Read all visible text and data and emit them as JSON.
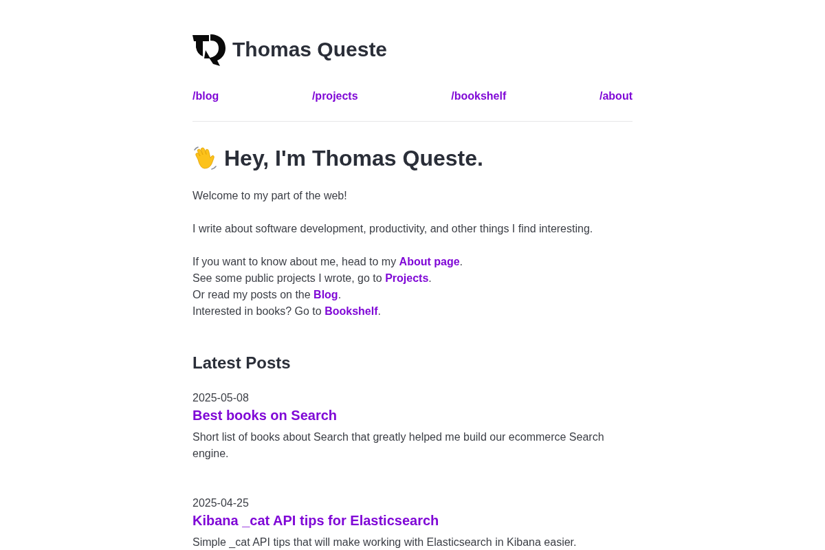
{
  "header": {
    "title": "Thomas Queste"
  },
  "nav": [
    {
      "label": "/blog"
    },
    {
      "label": "/projects"
    },
    {
      "label": "/bookshelf"
    },
    {
      "label": "/about"
    }
  ],
  "intro": {
    "heading": "Hey, I'm Thomas Queste.",
    "paragraphs": [
      "Welcome to my part of the web!",
      "I write about software development, productivity, and other things I find interesting."
    ],
    "link_lines": [
      {
        "before": "If you want to know about me, head to my ",
        "link": "About page",
        "after": "."
      },
      {
        "before": "See some public projects I wrote, go to ",
        "link": "Projects",
        "after": "."
      },
      {
        "before": "Or read my posts on the ",
        "link": "Blog",
        "after": "."
      },
      {
        "before": "Interested in books? Go to ",
        "link": "Bookshelf",
        "after": "."
      }
    ]
  },
  "latest_posts": {
    "heading": "Latest Posts",
    "posts": [
      {
        "date": "2025-05-08",
        "title": "Best books on Search",
        "summary": "Short list of books about Search that greatly helped me build our ecommerce Search engine."
      },
      {
        "date": "2025-04-25",
        "title": "Kibana _cat API tips for Elasticsearch",
        "summary": "Simple _cat API tips that will make working with Elasticsearch in Kibana easier."
      }
    ]
  }
}
